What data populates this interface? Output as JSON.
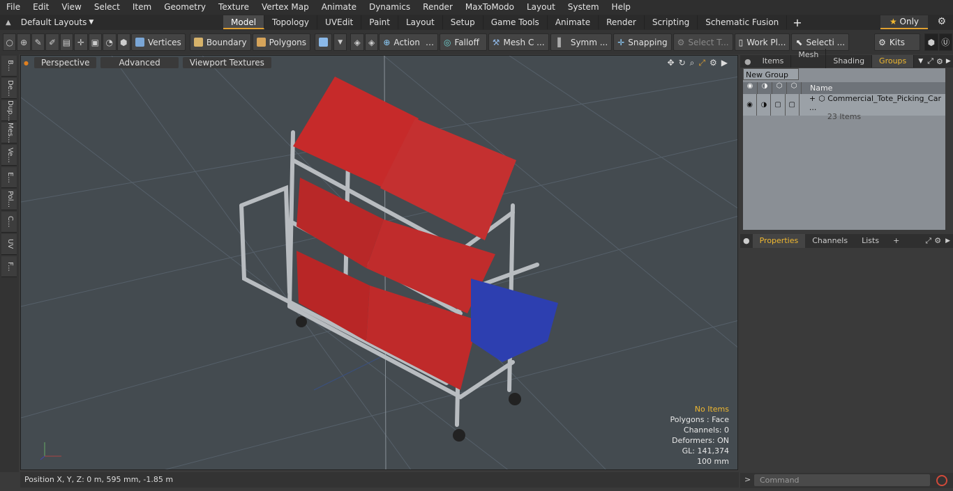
{
  "menu": [
    "File",
    "Edit",
    "View",
    "Select",
    "Item",
    "Geometry",
    "Texture",
    "Vertex Map",
    "Animate",
    "Dynamics",
    "Render",
    "MaxToModo",
    "Layout",
    "System",
    "Help"
  ],
  "layouts": {
    "label": "Default Layouts"
  },
  "tabs": [
    "Model",
    "Topology",
    "UVEdit",
    "Paint",
    "Layout",
    "Setup",
    "Game Tools",
    "Animate",
    "Render",
    "Scripting",
    "Schematic Fusion"
  ],
  "active_tab": "Model",
  "only_label": "Only",
  "toolbar": {
    "vertices": "Vertices",
    "boundary": "Boundary",
    "polygons": "Polygons",
    "action": "Action",
    "falloff": "Falloff",
    "meshc": "Mesh C ...",
    "symm": "Symm ...",
    "snapping": "Snapping",
    "selectt": "Select T...",
    "workpl": "Work Pl...",
    "selecti": "Selecti ...",
    "kits": "Kits"
  },
  "left_tabs": [
    "B...",
    "De...",
    "Dup...",
    "Mes...",
    "Ve...",
    "E...",
    "Pol...",
    "C...",
    "UV",
    "F..."
  ],
  "viewport": {
    "perspective": "Perspective",
    "advanced": "Advanced",
    "textures": "Viewport Textures",
    "info": {
      "no_items": "No Items",
      "polygons": "Polygons : Face",
      "channels": "Channels: 0",
      "deformers": "Deformers: ON",
      "gl": "GL: 141,374",
      "scale": "100 mm"
    }
  },
  "status": {
    "position": "Position X, Y, Z:   0 m, 595 mm, -1.85 m"
  },
  "right": {
    "tabs": [
      "Items",
      "Mesh ...",
      "Shading",
      "Groups"
    ],
    "new_group": "New Group",
    "name_header": "Name",
    "group_name": "Commercial_Tote_Picking_Car ...",
    "group_count": "23 Items",
    "props_tabs": [
      "Properties",
      "Channels",
      "Lists"
    ],
    "command_placeholder": "Command"
  }
}
